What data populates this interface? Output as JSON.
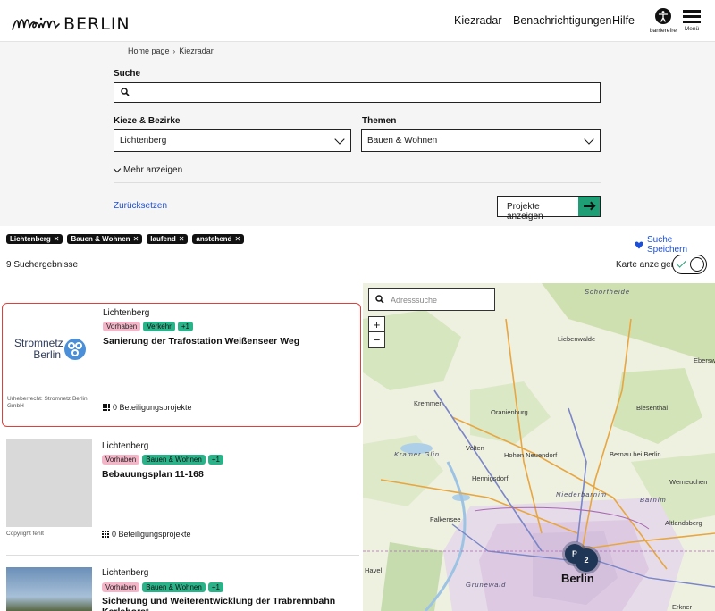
{
  "header": {
    "logo_word": "BERLIN",
    "nav": [
      "Kiezradar",
      "Benachrichtigungen",
      "Hilfe"
    ],
    "accessibility_label": "barrierefrei",
    "menu_label": "Menü"
  },
  "breadcrumb": [
    "Home page",
    "Kiezradar"
  ],
  "search": {
    "label": "Suche",
    "districts_label": "Kieze & Bezirke",
    "district_value": "Lichtenberg",
    "topics_label": "Themen",
    "topic_value": "Bauen & Wohnen",
    "more_label": "Mehr anzeigen",
    "reset_label": "Zurücksetzen",
    "submit_label": "Projekte anzeigen"
  },
  "chips": [
    "Lichtenberg",
    "Bauen & Wohnen",
    "laufend",
    "anstehend"
  ],
  "save_search_label": "Suche Speichern",
  "results_count": "9 Suchergebnisse",
  "map_toggle_label": "Karte anzeigen",
  "results": [
    {
      "district": "Lichtenberg",
      "badges": [
        "Vorhaben",
        "Verkehr",
        "+1"
      ],
      "title": "Sanierung der Trafostation Weißenseer Weg",
      "meta": "0 Beteiligungsprojekte",
      "copyright": "Urheberrecht: Stromnetz Berlin GmbH",
      "image_text_1": "Stromnetz",
      "image_text_2": "Berlin"
    },
    {
      "district": "Lichtenberg",
      "badges": [
        "Vorhaben",
        "Bauen & Wohnen",
        "+1"
      ],
      "title": "Bebauungsplan 11-168",
      "meta": "0 Beteiligungsprojekte",
      "copyright": "Copyright fehlt"
    },
    {
      "district": "Lichtenberg",
      "badges": [
        "Vorhaben",
        "Bauen & Wohnen",
        "+1"
      ],
      "title": "Sicherung und Weiterentwicklung der Trabrennbahn Karlshorst"
    }
  ],
  "map": {
    "search_placeholder": "Adresssuche",
    "zoom_in": "+",
    "zoom_out": "−",
    "places": [
      "Schorfheide",
      "Liebenwalde",
      "Eberswalde",
      "Kremmen",
      "Oranienburg",
      "Biesenthal",
      "Kramer Glin",
      "Velten",
      "Hohen Neuendorf",
      "Bernau bei Berlin",
      "Hennigsdorf",
      "Niederbarnim",
      "Barnim",
      "Werneuchen",
      "Falkensee",
      "Altlandsberg",
      "Havel",
      "Grunewald",
      "Berlin",
      "Erkner"
    ],
    "cluster_count": "2",
    "cluster_count_behind": "P"
  },
  "colors": {
    "accent_green": "#1f9e76",
    "link_blue": "#1c4fd8",
    "active_border": "#e0403a",
    "badge_pink": "#f3b6c9",
    "badge_green": "#2ab389"
  }
}
